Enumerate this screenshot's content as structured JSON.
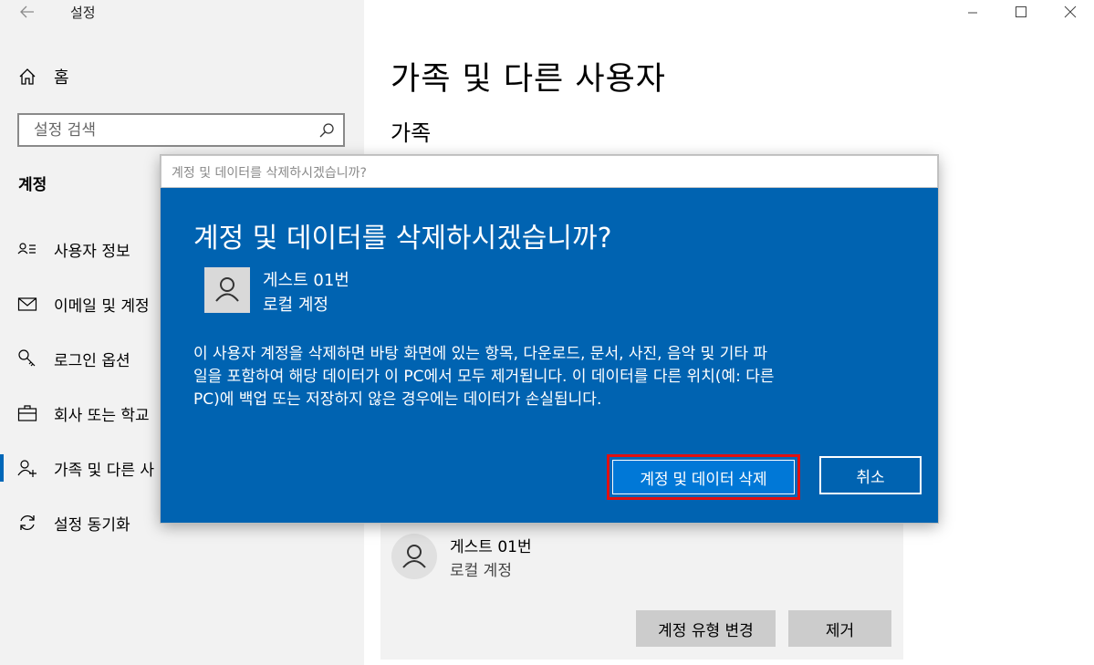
{
  "window": {
    "title": "설정"
  },
  "sidebar": {
    "home_label": "홈",
    "search_placeholder": "설정 검색",
    "section_title": "계정",
    "items": [
      {
        "label": "사용자 정보",
        "icon": "user-info-icon"
      },
      {
        "label": "이메일 및 계정",
        "icon": "mail-icon"
      },
      {
        "label": "로그인 옵션",
        "icon": "key-icon"
      },
      {
        "label": "회사 또는 학교",
        "icon": "briefcase-icon"
      },
      {
        "label": "가족 및 다른 사",
        "icon": "add-user-icon",
        "active": true
      },
      {
        "label": "설정 동기화",
        "icon": "sync-icon"
      }
    ]
  },
  "main": {
    "title": "가족 및 다른 사용자",
    "subtitle": "가족",
    "card": {
      "name": "게스트 01번",
      "type": "로컬 계정",
      "change_type_label": "계정 유형 변경",
      "remove_label": "제거"
    }
  },
  "dialog": {
    "window_title": "계정 및 데이터를 삭제하시겠습니까?",
    "heading": "계정 및 데이터를 삭제하시겠습니까?",
    "user_name": "게스트 01번",
    "user_type": "로컬 계정",
    "body_lines": [
      "이 사용자 계정을 삭제하면 바탕 화면에 있는 항목, 다운로드, 문서, 사진, 음악 및 기타 파",
      "일을 포함하여 해당 데이터가 이 PC에서 모두 제거됩니다. 이 데이터를 다른 위치(예: 다른",
      "PC)에 백업 또는 저장하지 않은 경우에는 데이터가 손실됩니다."
    ],
    "confirm_label": "계정 및 데이터 삭제",
    "cancel_label": "취소"
  },
  "colors": {
    "accent": "#0078d7",
    "dialog_bg": "#0063b1",
    "highlight": "#e01010",
    "sidebar_bg": "#f2f2f2"
  }
}
